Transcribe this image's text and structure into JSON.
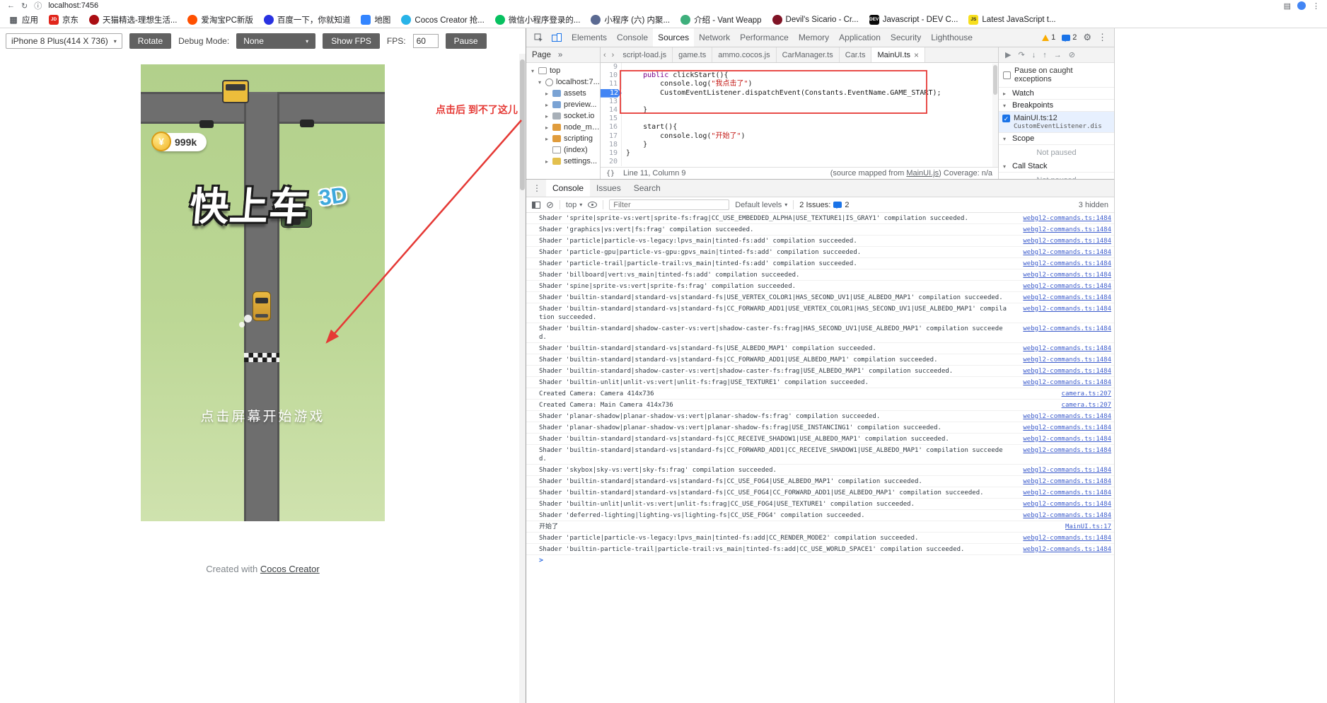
{
  "colors": {
    "accent_blue": "#1a73e8",
    "annotation_red": "#e53935",
    "grass_green": "#b9d593",
    "road_gray": "#6e6e6e",
    "coin_gold": "#f2b52a",
    "title_blue": "#3fa9dc",
    "warning_yellow": "#f9ab00"
  },
  "glyphs": {
    "back": "←",
    "reload": "↻",
    "info": "ⓘ",
    "side_panel": "▤",
    "kebab": "⋮",
    "gear": "⚙",
    "apps": "▦",
    "caret_down": "▾",
    "caret_right": "▸",
    "more": "»",
    "chev_left": "‹",
    "chev_right": "›",
    "close": "×",
    "braces": "{}",
    "block": "⊘",
    "check": "✓",
    "yen": "¥",
    "prompt": ">"
  },
  "browser": {
    "url": "localhost:7456",
    "bookmarks": [
      {
        "label": "应用",
        "type": "apps"
      },
      {
        "label": "京东",
        "color": "#e1251b",
        "initial": "JD",
        "square": true
      },
      {
        "label": "天猫精选-理想生活...",
        "color": "#aa0d12"
      },
      {
        "label": "爱淘宝PC新版",
        "color": "#ff5000"
      },
      {
        "label": "百度一下，你就知道",
        "color": "#2932e1"
      },
      {
        "label": "地图",
        "color": "#3385ff",
        "square": true
      },
      {
        "label": "Cocos Creator 抢...",
        "color": "#28b3e8"
      },
      {
        "label": "微信小程序登录的...",
        "color": "#07c160"
      },
      {
        "label": "小程序 (六) 内聚...",
        "color": "#5b6a92"
      },
      {
        "label": "介绍 - Vant Weapp",
        "color": "#3eaf7c"
      },
      {
        "label": "Devil's Sicario - Cr...",
        "color": "#801325"
      },
      {
        "label": "Javascript - DEV C...",
        "color": "#0a0a0a",
        "initial": "DEV",
        "square": true
      },
      {
        "label": "Latest JavaScript t...",
        "color": "#f7df1e",
        "initial": "JS",
        "square": true,
        "dark_text": true
      }
    ]
  },
  "preview_toolbar": {
    "device": "iPhone 8 Plus(414 X 736)",
    "rotate": "Rotate",
    "debug_mode_label": "Debug Mode:",
    "debug_mode_value": "None",
    "show_fps": "Show FPS",
    "fps_label": "FPS:",
    "fps_value": "60",
    "pause": "Pause"
  },
  "game": {
    "coins": "999k",
    "coin_symbol": "¥",
    "title": "快上车",
    "title_3d": "3D",
    "start_hint": "点击屏幕开始游戏",
    "footer_prefix": "Created with ",
    "footer_link": "Cocos Creator"
  },
  "annotations": {
    "note": "点击后 到不了这儿"
  },
  "devtools": {
    "tabs": [
      "Elements",
      "Console",
      "Sources",
      "Network",
      "Performance",
      "Memory",
      "Application",
      "Security",
      "Lighthouse"
    ],
    "active_tab": "Sources",
    "warning_count": "1",
    "message_count": "2",
    "nav": {
      "page_tab": "Page",
      "tree": [
        {
          "label": "top",
          "icon": "frame",
          "depth": 0,
          "arrow": true,
          "expanded": true
        },
        {
          "label": "localhost:7...",
          "icon": "globe",
          "depth": 1,
          "arrow": true,
          "expanded": true
        },
        {
          "label": "assets",
          "icon": "folder-blue",
          "depth": 2,
          "arrow": true,
          "expanded": false
        },
        {
          "label": "preview...",
          "icon": "folder-blue",
          "depth": 2,
          "arrow": true,
          "expanded": false
        },
        {
          "label": "socket.io",
          "icon": "folder-gray",
          "depth": 2,
          "arrow": true,
          "expanded": false
        },
        {
          "label": "node_mo...",
          "icon": "folder-orange",
          "depth": 2,
          "arrow": true,
          "expanded": false
        },
        {
          "label": "scripting",
          "icon": "folder-orange",
          "depth": 2,
          "arrow": true,
          "expanded": false
        },
        {
          "label": "(index)",
          "icon": "file",
          "depth": 2,
          "arrow": false
        },
        {
          "label": "settings...",
          "icon": "folder-yellow",
          "depth": 2,
          "arrow": true,
          "expanded": false
        }
      ]
    },
    "editor": {
      "tabs": [
        "script-load.js",
        "game.ts",
        "ammo.cocos.js",
        "CarManager.ts",
        "Car.ts",
        "MainUI.ts"
      ],
      "active": "MainUI.ts",
      "lines": [
        {
          "num": 9,
          "seg": []
        },
        {
          "num": 10,
          "seg": [
            {
              "t": "    "
            },
            {
              "t": "public",
              "c": "kw"
            },
            {
              "t": " clickStart(){"
            }
          ]
        },
        {
          "num": 11,
          "seg": [
            {
              "t": "        console.log("
            },
            {
              "t": "\"我点击了\"",
              "c": "str"
            },
            {
              "t": ")"
            }
          ]
        },
        {
          "num": 12,
          "bp": true,
          "seg": [
            {
              "t": "        CustomEventListener.dispatchEvent(Constants.EventName.GAME_START);"
            }
          ]
        },
        {
          "num": 13,
          "seg": []
        },
        {
          "num": 14,
          "seg": [
            {
              "t": "    }"
            }
          ]
        },
        {
          "num": 15,
          "seg": []
        },
        {
          "num": 16,
          "seg": [
            {
              "t": "    start(){"
            }
          ]
        },
        {
          "num": 17,
          "seg": [
            {
              "t": "        console.log("
            },
            {
              "t": "\"开始了\"",
              "c": "str"
            },
            {
              "t": ")"
            }
          ]
        },
        {
          "num": 18,
          "seg": [
            {
              "t": "    }"
            }
          ]
        },
        {
          "num": 19,
          "seg": [
            {
              "t": "}"
            }
          ]
        },
        {
          "num": 20,
          "seg": []
        }
      ],
      "status": {
        "line_col": "Line 11, Column 9",
        "mapped_pre": "(source mapped from ",
        "mapped_link": "MainUI.js",
        "mapped_post": ") Coverage: n/a"
      }
    },
    "debugger": {
      "controls": [
        {
          "name": "resume-icon",
          "glyph": "▶"
        },
        {
          "name": "step-over-icon",
          "glyph": "↷"
        },
        {
          "name": "step-into-icon",
          "glyph": "↓"
        },
        {
          "name": "step-out-icon",
          "glyph": "↑"
        },
        {
          "name": "step-icon",
          "glyph": "→"
        },
        {
          "name": "deactivate-breakpoints-icon",
          "glyph": "⊘"
        }
      ],
      "pause_on_caught": "Pause on caught exceptions",
      "sections": [
        "Watch",
        "Breakpoints",
        "Scope",
        "Call Stack"
      ],
      "breakpoint": {
        "file": "MainUI.ts:12",
        "snippet": "CustomEventListener.dis"
      },
      "not_paused": "Not paused"
    },
    "console": {
      "tabs": [
        "Console",
        "Issues",
        "Search"
      ],
      "active_tab": "Console",
      "context": "top",
      "filter_placeholder": "Filter",
      "levels": "Default levels",
      "issues_label": "2 Issues:",
      "issues_count": "2",
      "hidden": "3 hidden",
      "messages": [
        {
          "text": "Shader 'sprite|sprite-vs:vert|sprite-fs:frag|CC_USE_EMBEDDED_ALPHA|USE_TEXTURE1|IS_GRAY1' compilation succeeded.",
          "link": "webgl2-commands.ts:1484"
        },
        {
          "text": "Shader 'graphics|vs:vert|fs:frag' compilation succeeded.",
          "link": "webgl2-commands.ts:1484"
        },
        {
          "text": "Shader 'particle|particle-vs-legacy:lpvs_main|tinted-fs:add' compilation succeeded.",
          "link": "webgl2-commands.ts:1484"
        },
        {
          "text": "Shader 'particle-gpu|particle-vs-gpu:gpvs_main|tinted-fs:add' compilation succeeded.",
          "link": "webgl2-commands.ts:1484"
        },
        {
          "text": "Shader 'particle-trail|particle-trail:vs_main|tinted-fs:add' compilation succeeded.",
          "link": "webgl2-commands.ts:1484"
        },
        {
          "text": "Shader 'billboard|vert:vs_main|tinted-fs:add' compilation succeeded.",
          "link": "webgl2-commands.ts:1484"
        },
        {
          "text": "Shader 'spine|sprite-vs:vert|sprite-fs:frag' compilation succeeded.",
          "link": "webgl2-commands.ts:1484"
        },
        {
          "text": "Shader 'builtin-standard|standard-vs|standard-fs|USE_VERTEX_COLOR1|HAS_SECOND_UV1|USE_ALBEDO_MAP1' compilation succeeded.",
          "link": "webgl2-commands.ts:1484"
        },
        {
          "text": "Shader 'builtin-standard|standard-vs|standard-fs|CC_FORWARD_ADD1|USE_VERTEX_COLOR1|HAS_SECOND_UV1|USE_ALBEDO_MAP1' compilation succeeded.",
          "link": "webgl2-commands.ts:1484"
        },
        {
          "text": "Shader 'builtin-standard|shadow-caster-vs:vert|shadow-caster-fs:frag|HAS_SECOND_UV1|USE_ALBEDO_MAP1' compilation succeeded.",
          "link": "webgl2-commands.ts:1484"
        },
        {
          "text": "Shader 'builtin-standard|standard-vs|standard-fs|USE_ALBEDO_MAP1' compilation succeeded.",
          "link": "webgl2-commands.ts:1484"
        },
        {
          "text": "Shader 'builtin-standard|standard-vs|standard-fs|CC_FORWARD_ADD1|USE_ALBEDO_MAP1' compilation succeeded.",
          "link": "webgl2-commands.ts:1484"
        },
        {
          "text": "Shader 'builtin-standard|shadow-caster-vs:vert|shadow-caster-fs:frag|USE_ALBEDO_MAP1' compilation succeeded.",
          "link": "webgl2-commands.ts:1484"
        },
        {
          "text": "Shader 'builtin-unlit|unlit-vs:vert|unlit-fs:frag|USE_TEXTURE1' compilation succeeded.",
          "link": "webgl2-commands.ts:1484"
        },
        {
          "text": "Created Camera: Camera 414x736",
          "link": "camera.ts:207"
        },
        {
          "text": "Created Camera: Main Camera 414x736",
          "link": "camera.ts:207"
        },
        {
          "text": "Shader 'planar-shadow|planar-shadow-vs:vert|planar-shadow-fs:frag' compilation succeeded.",
          "link": "webgl2-commands.ts:1484"
        },
        {
          "text": "Shader 'planar-shadow|planar-shadow-vs:vert|planar-shadow-fs:frag|USE_INSTANCING1' compilation succeeded.",
          "link": "webgl2-commands.ts:1484"
        },
        {
          "text": "Shader 'builtin-standard|standard-vs|standard-fs|CC_RECEIVE_SHADOW1|USE_ALBEDO_MAP1' compilation succeeded.",
          "link": "webgl2-commands.ts:1484"
        },
        {
          "text": "Shader 'builtin-standard|standard-vs|standard-fs|CC_FORWARD_ADD1|CC_RECEIVE_SHADOW1|USE_ALBEDO_MAP1' compilation succeeded.",
          "link": "webgl2-commands.ts:1484"
        },
        {
          "text": "Shader 'skybox|sky-vs:vert|sky-fs:frag' compilation succeeded.",
          "link": "webgl2-commands.ts:1484"
        },
        {
          "text": "Shader 'builtin-standard|standard-vs|standard-fs|CC_USE_FOG4|USE_ALBEDO_MAP1' compilation succeeded.",
          "link": "webgl2-commands.ts:1484"
        },
        {
          "text": "Shader 'builtin-standard|standard-vs|standard-fs|CC_USE_FOG4|CC_FORWARD_ADD1|USE_ALBEDO_MAP1' compilation succeeded.",
          "link": "webgl2-commands.ts:1484"
        },
        {
          "text": "Shader 'builtin-unlit|unlit-vs:vert|unlit-fs:frag|CC_USE_FOG4|USE_TEXTURE1' compilation succeeded.",
          "link": "webgl2-commands.ts:1484"
        },
        {
          "text": "Shader 'deferred-lighting|lighting-vs|lighting-fs|CC_USE_FOG4' compilation succeeded.",
          "link": "webgl2-commands.ts:1484"
        },
        {
          "text": "开始了",
          "link": "MainUI.ts:17"
        },
        {
          "text": "Shader 'particle|particle-vs-legacy:lpvs_main|tinted-fs:add|CC_RENDER_MODE2' compilation succeeded.",
          "link": "webgl2-commands.ts:1484"
        },
        {
          "text": "Shader 'builtin-particle-trail|particle-trail:vs_main|tinted-fs:add|CC_USE_WORLD_SPACE1' compilation succeeded.",
          "link": "webgl2-commands.ts:1484"
        }
      ]
    }
  }
}
